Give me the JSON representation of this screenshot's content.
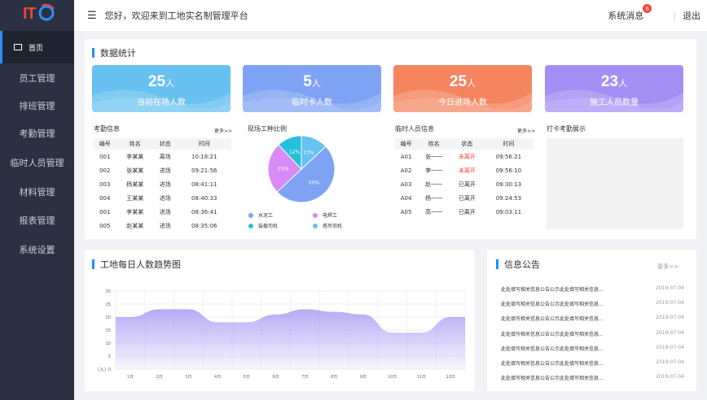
{
  "app": {
    "logo_text": "IT",
    "welcome": "您好，欢迎来到工地实名制管理平台",
    "messages_label": "系统消息",
    "messages_count": "6",
    "separator": "|",
    "logout": "退出"
  },
  "sidebar": {
    "items": [
      {
        "label": "首页"
      },
      {
        "label": "员工管理"
      },
      {
        "label": "排班管理"
      },
      {
        "label": "考勤管理"
      },
      {
        "label": "临时人员管理"
      },
      {
        "label": "材料管理"
      },
      {
        "label": "报表管理"
      },
      {
        "label": "系统设置"
      }
    ]
  },
  "stats": {
    "title": "数据统计",
    "cards": [
      {
        "value": "25",
        "unit": "人",
        "label": "当前在场人数",
        "color": "#68c1f1"
      },
      {
        "value": "5",
        "unit": "人",
        "label": "临时卡人数",
        "color": "#7fa3f4"
      },
      {
        "value": "25",
        "unit": "人",
        "label": "今日进场人数",
        "color": "#f5855f"
      },
      {
        "value": "23",
        "unit": "人",
        "label": "施工人员数量",
        "color": "#a38ff4"
      }
    ]
  },
  "attendance": {
    "title": "考勤信息",
    "more": "更多>>",
    "headers": [
      "编号",
      "姓名",
      "状态",
      "时间"
    ],
    "rows": [
      [
        "001",
        "李某某",
        "离场",
        "10:18:21"
      ],
      [
        "002",
        "张某某",
        "进场",
        "09:21:56"
      ],
      [
        "003",
        "杨某某",
        "进场",
        "08:41:11"
      ],
      [
        "004",
        "王某某",
        "进场",
        "08:40:33"
      ],
      [
        "001",
        "李某某",
        "进场",
        "08:36:41"
      ],
      [
        "005",
        "赵某某",
        "进场",
        "08:35:06"
      ]
    ]
  },
  "trades": {
    "title": "现场工种比例",
    "chart_data": {
      "type": "pie",
      "slices": [
        {
          "name": "水泥工",
          "value": 50,
          "label": "50%",
          "color": "#7fa3f4"
        },
        {
          "name": "电焊工",
          "value": 25,
          "label": "25%",
          "color": "#d88af6"
        },
        {
          "name": "装载司机",
          "value": 12,
          "label": "12%",
          "color": "#27c0dc"
        },
        {
          "name": "塔吊司机",
          "value": 13,
          "label": "13%",
          "color": "#68c1f1"
        }
      ]
    }
  },
  "temp": {
    "title": "临时人员信息",
    "more": "更多>>",
    "headers": [
      "编号",
      "姓名",
      "状态",
      "时间"
    ],
    "rows": [
      [
        "A01",
        "张一一",
        "未离开",
        "09:56:21"
      ],
      [
        "A02",
        "李一一",
        "未离开",
        "09:56:10"
      ],
      [
        "A03",
        "赵一一",
        "已离开",
        "09:30:13"
      ],
      [
        "A04",
        "杨一一",
        "已离开",
        "09:24:53"
      ],
      [
        "A05",
        "高一一",
        "已离开",
        "09:03:11"
      ]
    ]
  },
  "punch": {
    "title": "打卡考勤展示"
  },
  "trend": {
    "title": "工地每日人数趋势图",
    "chart_data": {
      "type": "area",
      "x": [
        "1日",
        "2日",
        "3日",
        "4日",
        "5日",
        "6日",
        "7日",
        "8日",
        "9日",
        "10日",
        "11日",
        "12日"
      ],
      "values": [
        20,
        23,
        23,
        18,
        18,
        21,
        23,
        22,
        21,
        14,
        14,
        20
      ],
      "ylabel": "（人）",
      "yticks": [
        0,
        5,
        10,
        15,
        20,
        25,
        30
      ],
      "ylim": [
        0,
        30
      ],
      "grid": true,
      "color": "#a99cf3"
    }
  },
  "notice": {
    "title": "信息公告",
    "more": "更多>>",
    "items": [
      {
        "text": "此处填写相关信息公告公示此处填写相关信息...",
        "date": "2019-07-04"
      },
      {
        "text": "此处填写相关信息公告公示此处填写相关信息...",
        "date": "2019-07-04"
      },
      {
        "text": "此处填写相关信息公告公示此处填写相关信息...",
        "date": "2019-07-04"
      },
      {
        "text": "此处填写相关信息公告公示此处填写相关信息...",
        "date": "2019-07-04"
      },
      {
        "text": "此处填写相关信息公告公示此处填写相关信息...",
        "date": "2019-07-04"
      },
      {
        "text": "此处填写相关信息公告公示此处填写相关信息...",
        "date": "2019-07-04"
      },
      {
        "text": "此处填写相关信息公告公示此处填写相关信息...",
        "date": "2019-07-04"
      }
    ]
  }
}
